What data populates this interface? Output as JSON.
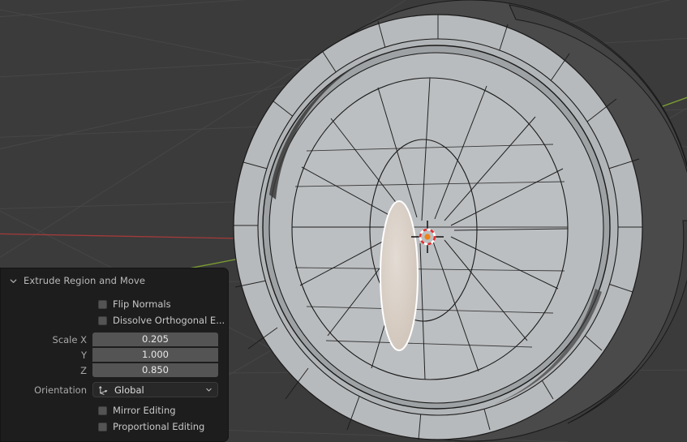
{
  "viewport": {
    "name": "3d-viewport",
    "background_color": "#3b3b3b",
    "grid_line_color": "#4a4a4a",
    "axis_x_color": "#a33b3b",
    "axis_y_color": "#7ea331",
    "cursor": {
      "name": "3d-cursor",
      "origin_color": "#ee8318",
      "ring_colors": [
        "#ffffff",
        "#e03030"
      ]
    },
    "mesh": {
      "name": "wheel-mesh",
      "object_type": "torus-wheel",
      "mode": "Edit Mode",
      "wire_color": "#1a1a1a",
      "face_light": "#b9bcbd",
      "face_mid": "#9fa3a5",
      "face_dark": "#4c4c4c",
      "face_darker": "#3c3c3c",
      "selected_face_fill": "#d9cfc6",
      "selected_face_outline": "#ffffff"
    }
  },
  "operator_panel": {
    "name": "extrude-region-and-move-panel",
    "title": "Extrude Region and Move",
    "expanded": true,
    "collapse_icon": "chevron-down-icon",
    "checkboxes": [
      {
        "label": "Flip Normals",
        "checked": false
      },
      {
        "label": "Dissolve Orthogonal E...",
        "checked": false
      }
    ],
    "scale_fields": [
      {
        "label": "Scale X",
        "value": "0.205"
      },
      {
        "label": "Y",
        "value": "1.000"
      },
      {
        "label": "Z",
        "value": "0.850"
      }
    ],
    "orientation": {
      "label": "Orientation",
      "value": "Global",
      "icon": "orientation-axis-icon",
      "chevron": "chevron-down-icon"
    },
    "bottom_checkboxes": [
      {
        "label": "Mirror Editing",
        "checked": false
      },
      {
        "label": "Proportional Editing",
        "checked": false
      }
    ]
  }
}
